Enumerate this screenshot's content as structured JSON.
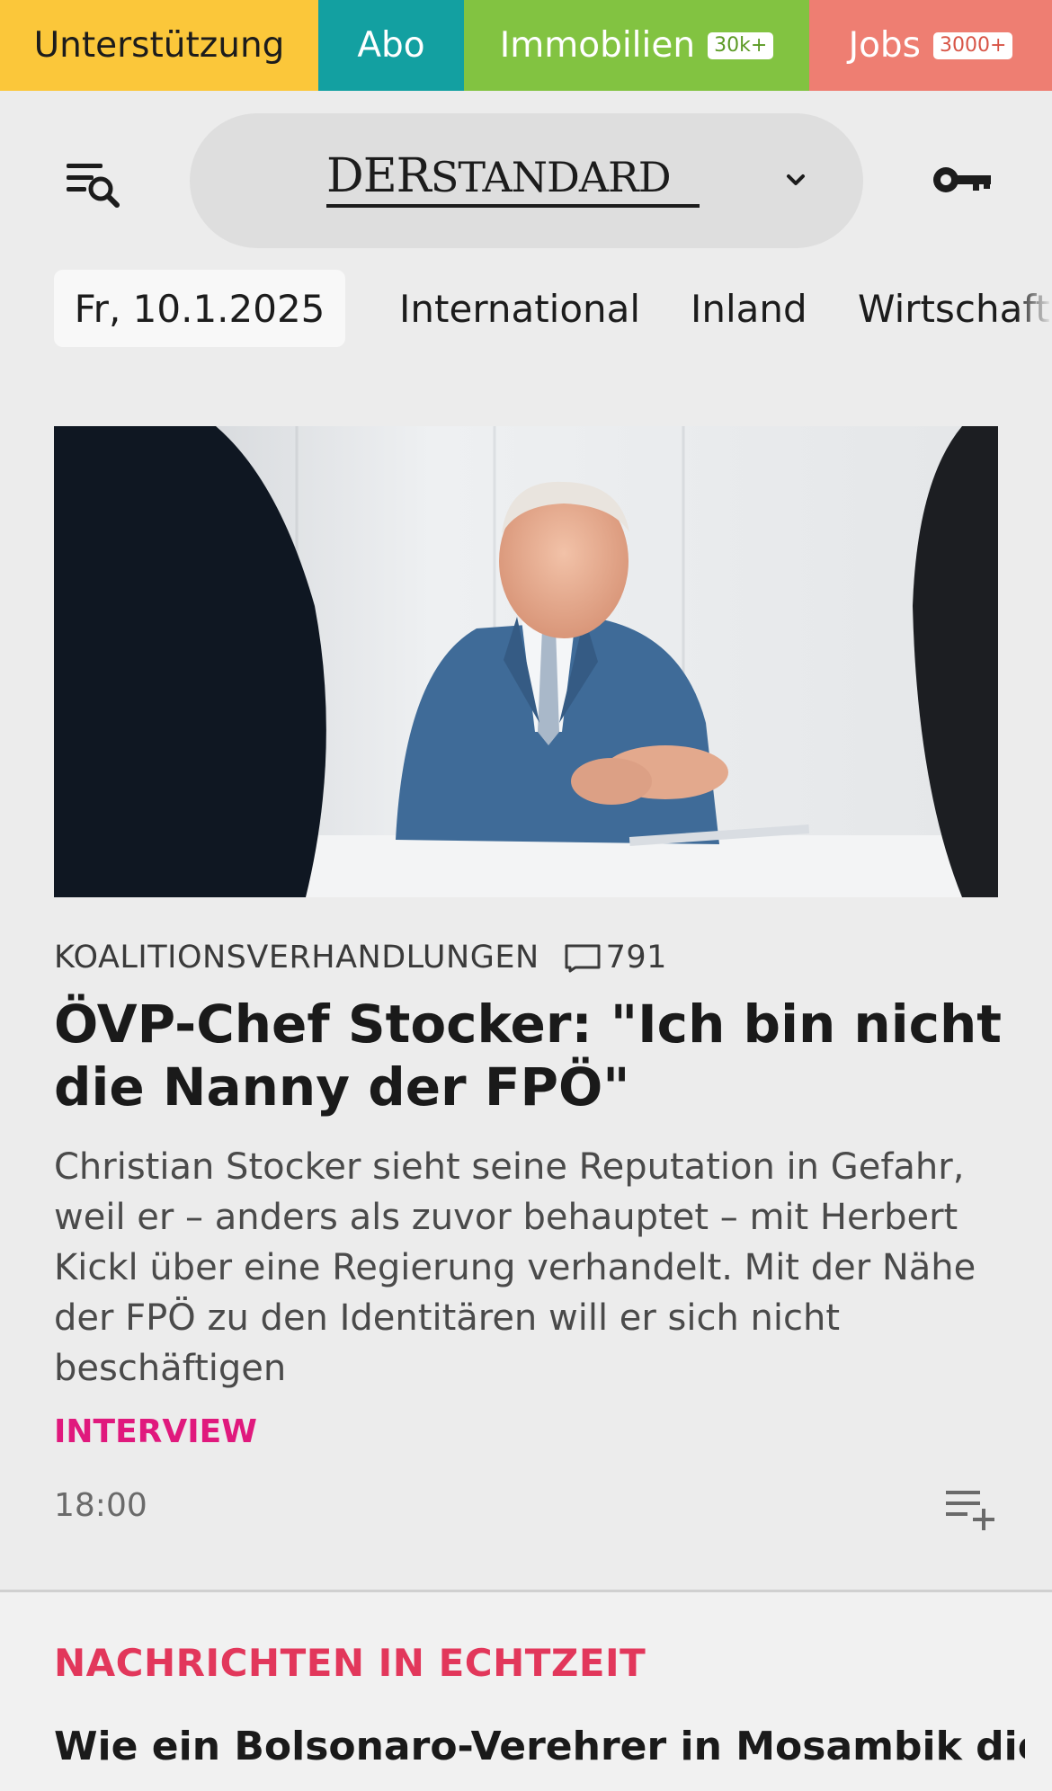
{
  "service_bar": {
    "support": "Unterstützung",
    "abo": "Abo",
    "immobilien": "Immobilien",
    "immobilien_badge": "30k+",
    "jobs": "Jobs",
    "jobs_badge": "3000+",
    "colors": {
      "support": "#fbc73a",
      "abo": "#13a0a1",
      "immobilien": "#82c341",
      "jobs": "#ee7e72"
    }
  },
  "header": {
    "menu_icon": "menu-search-icon",
    "logo_der": "DER",
    "logo_standard": "STANDARD",
    "chevron_icon": "chevron-down-icon",
    "login_icon": "key-icon"
  },
  "nav": {
    "date": "Fr, 10.1.2025",
    "items": [
      "International",
      "Inland",
      "Wirtschaft"
    ]
  },
  "article": {
    "kicker": "KOALITIONSVERHANDLUNGEN",
    "comments_icon": "comment-icon",
    "comments": "791",
    "headline": "ÖVP-Chef Stocker: \"Ich bin nicht die Nanny der FPÖ\"",
    "teaser": "Christian Stocker sieht seine Reputation in Gefahr, weil er – anders als zuvor behauptet – mit Herbert Kickl über eine Regierung verhandelt. Mit der Nähe der FPÖ zu den Identitären will er sich nicht beschäftigen",
    "tag": "INTERVIEW",
    "time": "18:00",
    "playlist_icon": "playlist-add-icon",
    "tag_color": "#e0197d"
  },
  "live": {
    "label": "NACHRICHTEN IN ECHTZEIT",
    "headline": "Wie ein Bolsonaro-Verehrer in Mosambik die Re-",
    "label_color": "#e2375b"
  }
}
